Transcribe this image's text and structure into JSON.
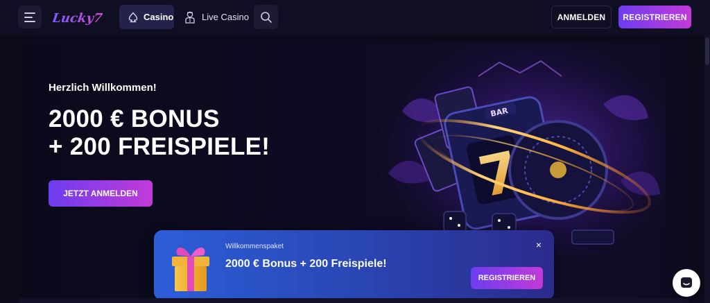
{
  "header": {
    "logo_text": "Lucky7",
    "nav": [
      {
        "label": "Casino",
        "icon": "spade-icon",
        "active": true
      },
      {
        "label": "Live Casino",
        "icon": "dealer-icon",
        "active": false
      }
    ],
    "login_label": "ANMELDEN",
    "register_label": "REGISTRIEREN"
  },
  "hero": {
    "welcome": "Herzlich Willkommen!",
    "headline_line1": "2000 € BONUS",
    "headline_line2": "+ 200 FREISPIELE!",
    "cta_label": "JETZT ANMELDEN",
    "reel_label": "BAR"
  },
  "promo": {
    "subtitle": "Willkommenspaket",
    "title": "2000 € Bonus + 200 Freispiele!",
    "register_label": "REGISTRIEREN",
    "close_symbol": "×"
  },
  "colors": {
    "background": "#0c0b1c",
    "accent_gradient_start": "#6c3df0",
    "accent_gradient_end": "#c23ad8",
    "promo_blue": "#2c5ed8"
  }
}
